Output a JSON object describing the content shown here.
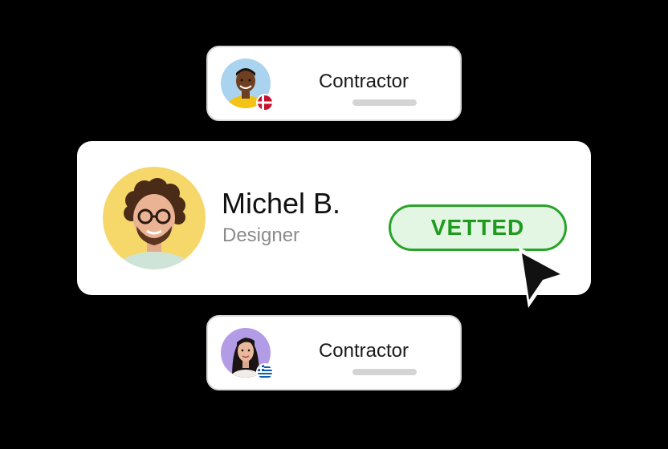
{
  "cards": {
    "top": {
      "label": "Contractor",
      "avatar_icon": "person-avatar-man-yellow-shirt",
      "flag_icon": "denmark-flag-icon"
    },
    "main": {
      "name": "Michel B.",
      "role": "Designer",
      "badge": "VETTED",
      "avatar_icon": "person-avatar-curly-hair-glasses",
      "cursor_icon": "mouse-pointer-icon"
    },
    "bottom": {
      "label": "Contractor",
      "avatar_icon": "person-avatar-woman-dark-hair",
      "flag_icon": "greece-flag-icon"
    }
  },
  "colors": {
    "background": "#000000",
    "card": "#ffffff",
    "badge_border": "#29a329",
    "badge_fill": "#e3f6e3",
    "badge_text": "#1e9a1e",
    "role_text": "#8a8a8a"
  }
}
